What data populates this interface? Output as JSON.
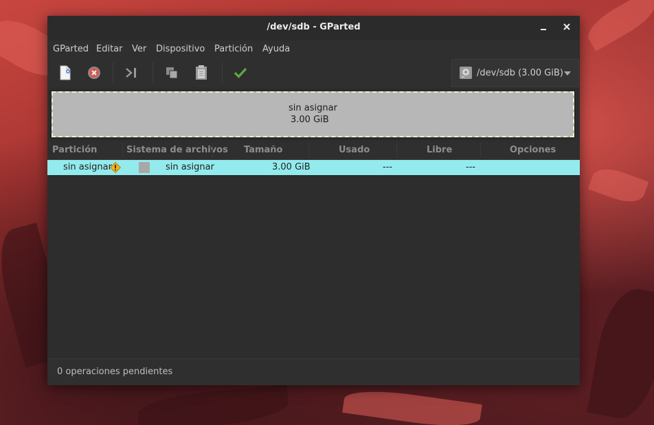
{
  "window": {
    "title": "/dev/sdb - GParted"
  },
  "menu": {
    "items": [
      {
        "id": "gparted",
        "label": "GParted"
      },
      {
        "id": "editar",
        "label": "Editar"
      },
      {
        "id": "ver",
        "label": "Ver"
      },
      {
        "id": "dispositivo",
        "label": "Dispositivo"
      },
      {
        "id": "particion",
        "label": "Partición"
      },
      {
        "id": "ayuda",
        "label": "Ayuda"
      }
    ]
  },
  "toolbar": {
    "buttons": [
      "new-partition-icon",
      "delete-icon",
      "resize-move-icon",
      "copy-icon",
      "paste-icon",
      "apply-icon"
    ],
    "device": "/dev/sdb (3.00 GiB)"
  },
  "map": {
    "name": "sin asignar",
    "size": "3.00 GiB"
  },
  "table": {
    "headers": [
      "Partición",
      "Sistema de archivos",
      "Tamaño",
      "Usado",
      "Libre",
      "Opciones"
    ],
    "rows": [
      {
        "particion": "sin asignar",
        "sistema": "sin asignar",
        "tamano": "3.00 GiB",
        "usado": "---",
        "libre": "---",
        "opciones": ""
      }
    ]
  },
  "status": {
    "text": "0 operaciones pendientes"
  },
  "colors": {
    "selected_row": "#93ebee",
    "apply_green": "#5fa93f",
    "warning": "#f0b323"
  }
}
